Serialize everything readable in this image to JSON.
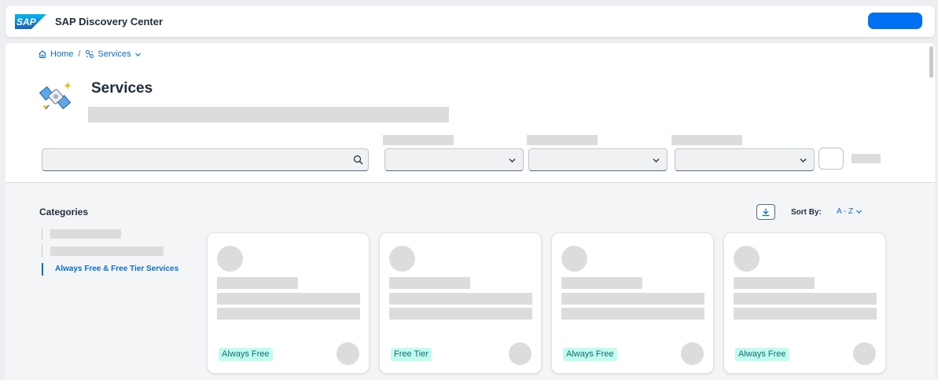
{
  "shell": {
    "title": "SAP Discovery Center",
    "logo_text": "SAP",
    "accent": "#0070f2"
  },
  "breadcrumb": {
    "home": "Home",
    "separator": "/",
    "current": "Services"
  },
  "page": {
    "title": "Services"
  },
  "categories": {
    "title": "Categories",
    "active_item": "Always Free & Free Tier Services"
  },
  "sort": {
    "label": "Sort By:",
    "value": "A - Z"
  },
  "cards": [
    {
      "tag": "Always Free"
    },
    {
      "tag": "Free Tier"
    },
    {
      "tag": "Always Free"
    },
    {
      "tag": "Always Free"
    }
  ],
  "icons": [
    "home-icon",
    "services-icon",
    "chevron-down-icon",
    "search-icon",
    "download-icon"
  ],
  "colors": {
    "link": "#0a6ed1",
    "tag_bg": "#c2fcee",
    "tag_text": "#0f6e72",
    "skeleton": "#dcdcdc"
  }
}
